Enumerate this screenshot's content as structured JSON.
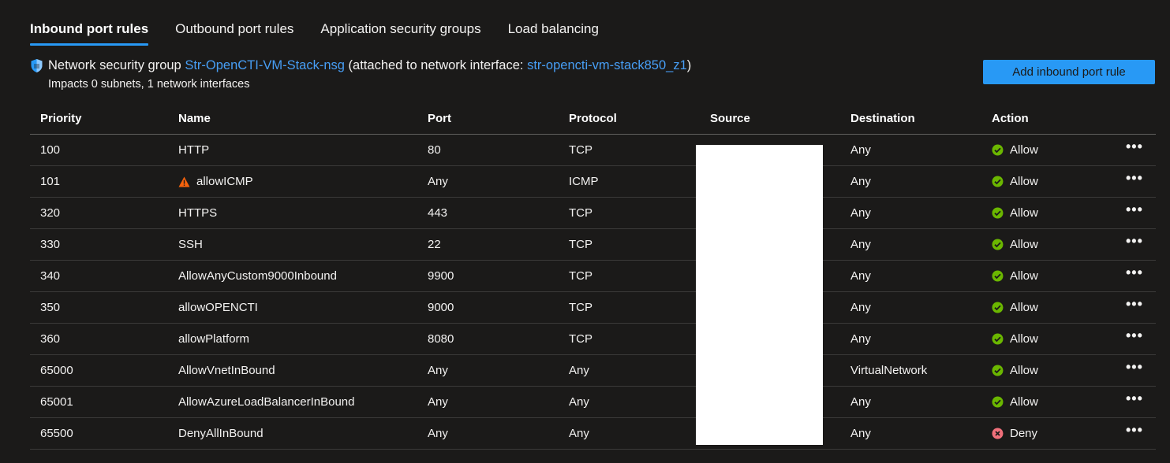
{
  "tabs": [
    {
      "label": "Inbound port rules",
      "active": true
    },
    {
      "label": "Outbound port rules",
      "active": false
    },
    {
      "label": "Application security groups",
      "active": false
    },
    {
      "label": "Load balancing",
      "active": false
    }
  ],
  "nsg": {
    "prefix": "Network security group",
    "name": "Str-OpenCTI-VM-Stack-nsg",
    "attached_prefix": "(attached to network interface:",
    "interface": "str-opencti-vm-stack850_z1",
    "attached_suffix": ")",
    "impacts": "Impacts 0 subnets, 1 network interfaces"
  },
  "add_button_label": "Add inbound port rule",
  "columns": {
    "priority": "Priority",
    "name": "Name",
    "port": "Port",
    "protocol": "Protocol",
    "source": "Source",
    "destination": "Destination",
    "action": "Action"
  },
  "rules": [
    {
      "priority": "100",
      "name": "HTTP",
      "warning": false,
      "port": "80",
      "protocol": "TCP",
      "destination": "Any",
      "action": "Allow"
    },
    {
      "priority": "101",
      "name": "allowICMP",
      "warning": true,
      "port": "Any",
      "protocol": "ICMP",
      "destination": "Any",
      "action": "Allow"
    },
    {
      "priority": "320",
      "name": "HTTPS",
      "warning": false,
      "port": "443",
      "protocol": "TCP",
      "destination": "Any",
      "action": "Allow"
    },
    {
      "priority": "330",
      "name": "SSH",
      "warning": false,
      "port": "22",
      "protocol": "TCP",
      "destination": "Any",
      "action": "Allow"
    },
    {
      "priority": "340",
      "name": "AllowAnyCustom9000Inbound",
      "warning": false,
      "port": "9900",
      "protocol": "TCP",
      "destination": "Any",
      "action": "Allow"
    },
    {
      "priority": "350",
      "name": "allowOPENCTI",
      "warning": false,
      "port": "9000",
      "protocol": "TCP",
      "destination": "Any",
      "action": "Allow"
    },
    {
      "priority": "360",
      "name": "allowPlatform",
      "warning": false,
      "port": "8080",
      "protocol": "TCP",
      "destination": "Any",
      "action": "Allow"
    },
    {
      "priority": "65000",
      "name": "AllowVnetInBound",
      "warning": false,
      "port": "Any",
      "protocol": "Any",
      "destination": "VirtualNetwork",
      "action": "Allow"
    },
    {
      "priority": "65001",
      "name": "AllowAzureLoadBalancerInBound",
      "warning": false,
      "port": "Any",
      "protocol": "Any",
      "destination": "Any",
      "action": "Allow"
    },
    {
      "priority": "65500",
      "name": "DenyAllInBound",
      "warning": false,
      "port": "Any",
      "protocol": "Any",
      "destination": "Any",
      "action": "Deny"
    }
  ],
  "more_label": "•••",
  "colors": {
    "background": "#1b1a19",
    "accent": "#2899f5",
    "link": "#479ef5",
    "allow": "#6bb700",
    "deny": "#f1707b",
    "warning": "#f7630c"
  }
}
